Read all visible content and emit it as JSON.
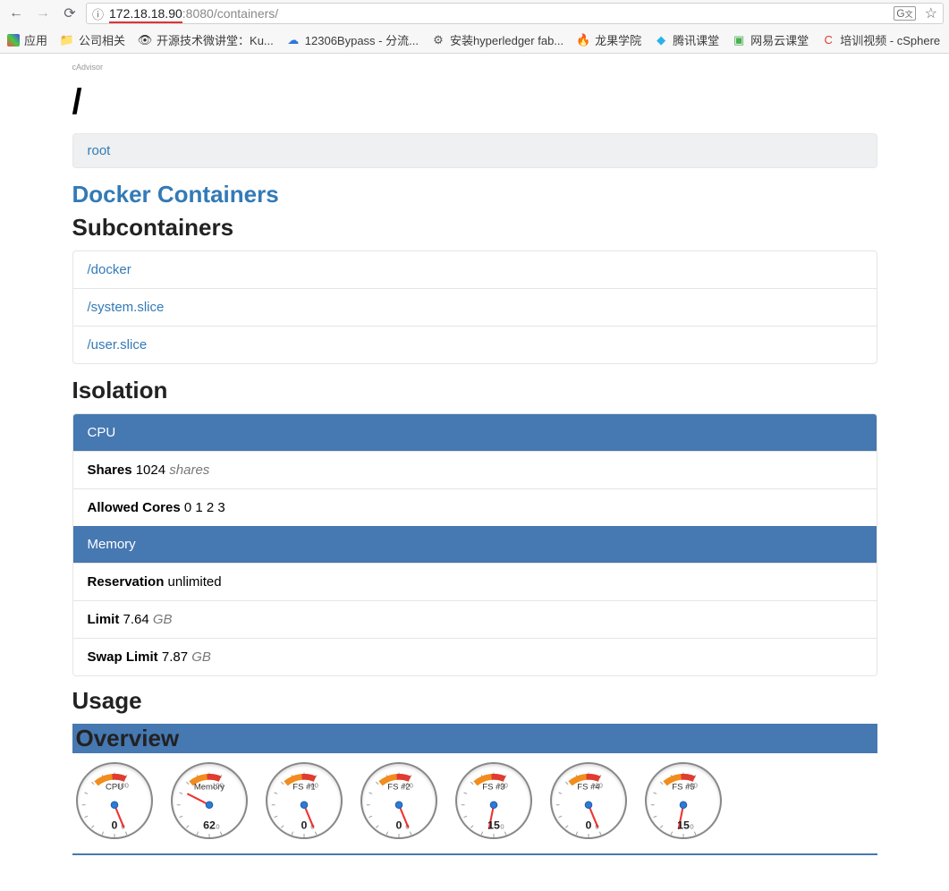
{
  "browser": {
    "url_host": "172.18.18.90",
    "url_port": ":8080",
    "url_path": "/containers/"
  },
  "bookmarks": {
    "apps": "应用",
    "items": [
      {
        "icon": "📁",
        "color": "#f7c948",
        "label": "公司相关"
      },
      {
        "icon": "👁",
        "color": "#333",
        "label": "开源技术微讲堂：Ku..."
      },
      {
        "icon": "☁",
        "color": "#2b7bd6",
        "label": "12306Bypass - 分流..."
      },
      {
        "icon": "⚙",
        "color": "#555",
        "label": "安装hyperledger fab..."
      },
      {
        "icon": "🔥",
        "color": "#e25822",
        "label": "龙果学院"
      },
      {
        "icon": "◆",
        "color": "#2bb0e8",
        "label": "腾讯课堂"
      },
      {
        "icon": "▣",
        "color": "#4caf50",
        "label": "网易云课堂"
      },
      {
        "icon": "C",
        "color": "#e03c31",
        "label": "培训视频 - cSphere"
      }
    ]
  },
  "page": {
    "brand": "cAdvisor",
    "title": "/",
    "breadcrumb_root": "root",
    "docker_containers": "Docker Containers",
    "subcontainers_heading": "Subcontainers",
    "subcontainers": [
      "/docker",
      "/system.slice",
      "/user.slice"
    ],
    "isolation_heading": "Isolation",
    "cpu_heading": "CPU",
    "shares_label": "Shares",
    "shares_value": "1024",
    "shares_unit": "shares",
    "allowed_cores_label": "Allowed Cores",
    "allowed_cores_value": "0 1 2 3",
    "memory_heading": "Memory",
    "reservation_label": "Reservation",
    "reservation_value": "unlimited",
    "limit_label": "Limit",
    "limit_value": "7.64",
    "limit_unit": "GB",
    "swap_label": "Swap Limit",
    "swap_value": "7.87",
    "swap_unit": "GB",
    "usage_heading": "Usage",
    "overview_heading": "Overview"
  },
  "chart_data": {
    "type": "table",
    "title": "Overview gauges",
    "series": [
      {
        "name": "CPU",
        "value": 0,
        "min": 0,
        "max": 100
      },
      {
        "name": "Memory",
        "value": 62,
        "min": 0,
        "max": 100
      },
      {
        "name": "FS #1",
        "value": 0,
        "min": 0,
        "max": 100
      },
      {
        "name": "FS #2",
        "value": 0,
        "min": 0,
        "max": 100
      },
      {
        "name": "FS #3",
        "value": 15,
        "min": 0,
        "max": 100
      },
      {
        "name": "FS #4",
        "value": 0,
        "min": 0,
        "max": 100
      },
      {
        "name": "FS #5",
        "value": 15,
        "min": 0,
        "max": 100
      }
    ]
  }
}
